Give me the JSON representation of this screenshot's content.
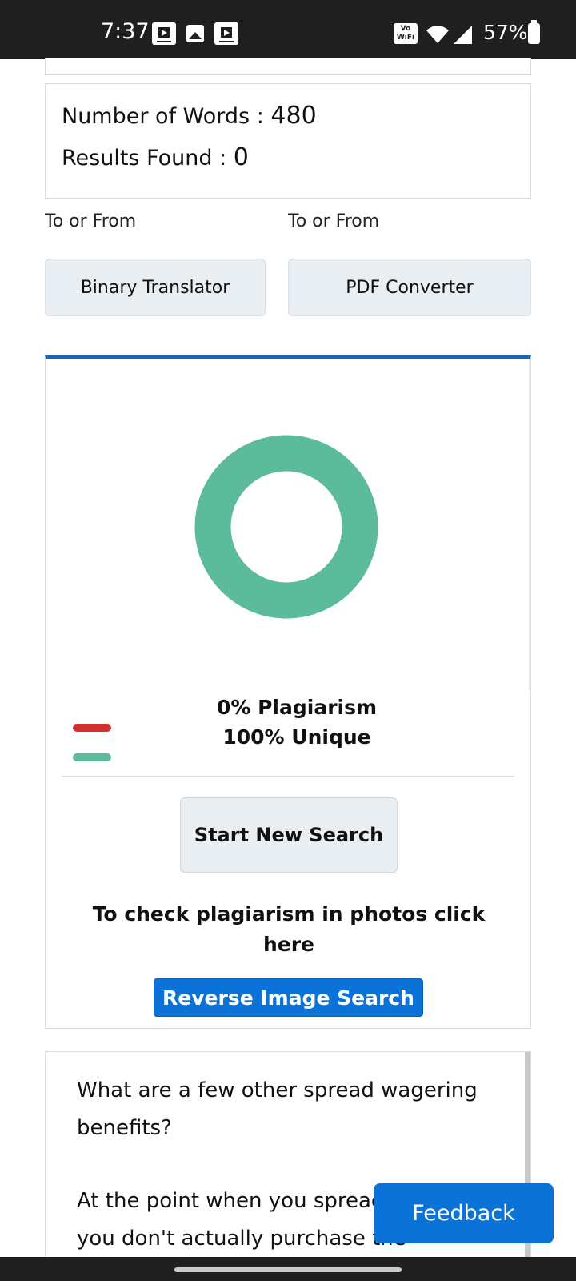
{
  "status_bar": {
    "time": "7:37",
    "vowifi_label": "Vo WiFi",
    "battery": "57%"
  },
  "stats": {
    "words_label": "Number of Words : ",
    "words_value": "480",
    "results_label": "Results Found : ",
    "results_value": "0"
  },
  "tools": [
    {
      "caption": "To or From",
      "label": "Binary Translator"
    },
    {
      "caption": "To or From",
      "label": "PDF Converter"
    }
  ],
  "result": {
    "plagiarism_percent": 0,
    "unique_percent": 100,
    "plagiarism_label": "0% Plagiarism",
    "unique_label": "100% Unique",
    "colors": {
      "plagiarism": "#d32f2f",
      "unique": "#5bbb9a",
      "accent": "#1565c0"
    },
    "start_button": "Start New Search",
    "photo_text": "To check plagiarism in photos click here",
    "reverse_button": "Reverse Image Search"
  },
  "article": {
    "paragraph1": "What are a few other spread wagering benefits?",
    "paragraph2": "At the point when you spread wager, you don't actually purchase the"
  },
  "feedback": {
    "label": "Feedback"
  }
}
